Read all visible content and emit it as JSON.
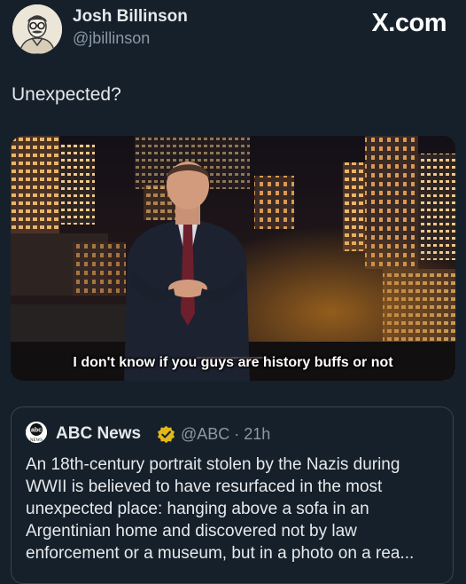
{
  "author": {
    "name": "Josh Billinson",
    "handle": "@jbillinson"
  },
  "brand": "X.com",
  "post": {
    "text": "Unexpected?"
  },
  "media": {
    "caption": "I don't know if you guys are history buffs or not"
  },
  "quoted": {
    "logo_text": "abc",
    "logo_subtext": "NEWS",
    "name": "ABC News",
    "handle_time": "@ABC · 21h",
    "badge_color": "#e2b719",
    "lines": [
      "An 18th-century portrait stolen by the Nazis during",
      "WWII is believed to have resurfaced in the most",
      "unexpected place: hanging above a sofa in an",
      "Argentinian home and discovered not by law",
      "enforcement or a museum, but in a photo on a rea..."
    ]
  }
}
